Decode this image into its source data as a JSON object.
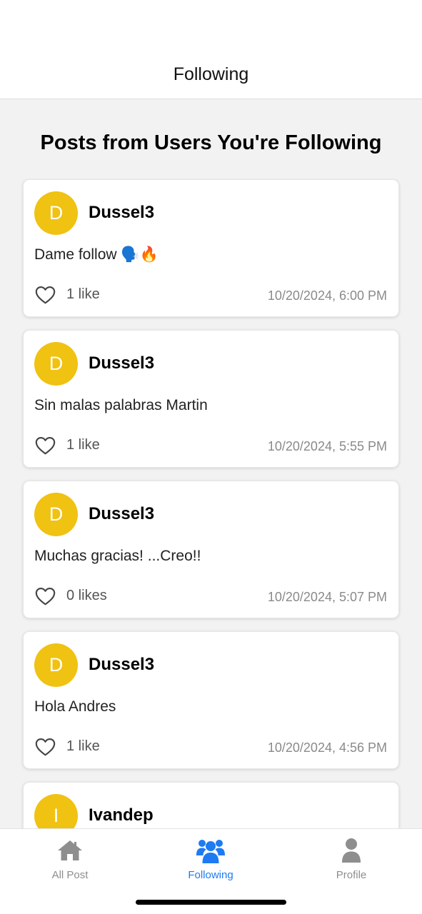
{
  "header": {
    "title": "Following"
  },
  "feed": {
    "title": "Posts from Users You're Following",
    "posts": [
      {
        "avatar_letter": "D",
        "username": "Dussel3",
        "content": "Dame follow 🗣️🔥",
        "likes": "1 like",
        "timestamp": "10/20/2024, 6:00 PM"
      },
      {
        "avatar_letter": "D",
        "username": "Dussel3",
        "content": "Sin malas palabras Martin",
        "likes": "1 like",
        "timestamp": "10/20/2024, 5:55 PM"
      },
      {
        "avatar_letter": "D",
        "username": "Dussel3",
        "content": "Muchas gracias! ...Creo!!",
        "likes": "0 likes",
        "timestamp": "10/20/2024, 5:07 PM"
      },
      {
        "avatar_letter": "D",
        "username": "Dussel3",
        "content": "Hola Andres",
        "likes": "1 like",
        "timestamp": "10/20/2024, 4:56 PM"
      },
      {
        "avatar_letter": "I",
        "username": "Ivandep",
        "content": "",
        "likes": "",
        "timestamp": ""
      }
    ]
  },
  "tabbar": {
    "tabs": [
      {
        "label": "All Post",
        "icon": "home-icon",
        "active": false
      },
      {
        "label": "Following",
        "icon": "users-icon",
        "active": true
      },
      {
        "label": "Profile",
        "icon": "user-icon",
        "active": false
      }
    ]
  },
  "colors": {
    "avatar": "#f0c211",
    "active_tab": "#1e7bf2",
    "inactive_tab": "#8e8e8e",
    "background": "#f2f2f2"
  }
}
